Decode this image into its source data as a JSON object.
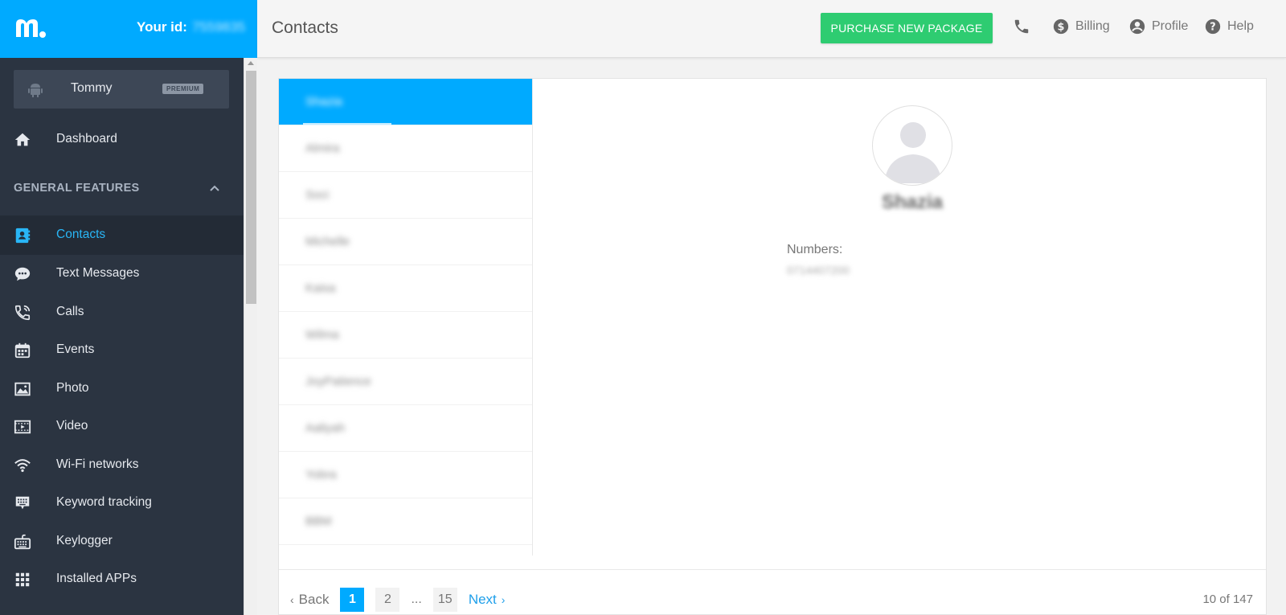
{
  "header": {
    "your_id_label": "Your id:",
    "your_id_value": "7559835",
    "page_title": "Contacts",
    "purchase_button": "PURCHASE NEW PACKAGE",
    "links": {
      "billing": "Billing",
      "profile": "Profile",
      "help": "Help"
    },
    "brand_color": "#00aaff"
  },
  "sidebar": {
    "device": {
      "name": "Tommy",
      "badge": "PREMIUM",
      "icon": "android-icon"
    },
    "dashboard": {
      "label": "Dashboard",
      "icon": "home-icon"
    },
    "section": {
      "label": "GENERAL FEATURES",
      "icon": "chevron-up-icon"
    },
    "items": [
      {
        "label": "Contacts",
        "icon": "contact-book-icon",
        "active": true
      },
      {
        "label": "Text Messages",
        "icon": "chat-bubble-icon"
      },
      {
        "label": "Calls",
        "icon": "phone-call-icon"
      },
      {
        "label": "Events",
        "icon": "calendar-icon"
      },
      {
        "label": "Photo",
        "icon": "image-icon"
      },
      {
        "label": "Video",
        "icon": "film-icon"
      },
      {
        "label": "Wi-Fi networks",
        "icon": "wifi-icon"
      },
      {
        "label": "Keyword tracking",
        "icon": "keyboard-chat-icon"
      },
      {
        "label": "Keylogger",
        "icon": "keyboard-icon"
      },
      {
        "label": "Installed APPs",
        "icon": "apps-grid-icon"
      }
    ],
    "bg_color": "#2b3441",
    "active_color": "#29b6f6"
  },
  "contacts": {
    "list": [
      "Shazia",
      "Almira",
      "Soci",
      "Michelle",
      "Kaisa",
      "Wilma",
      "JoyPatience",
      "Aaliyah",
      "Yobra",
      "BBM"
    ],
    "selected_index": 0
  },
  "detail": {
    "name": "Shazia",
    "numbers_label": "Numbers:",
    "numbers_value": "0714407200"
  },
  "pagination": {
    "back": "Back",
    "pages": [
      "1",
      "2"
    ],
    "ellipsis": "...",
    "last_page": "15",
    "next": "Next",
    "current_page": "1",
    "count_text": "10 of 147"
  }
}
